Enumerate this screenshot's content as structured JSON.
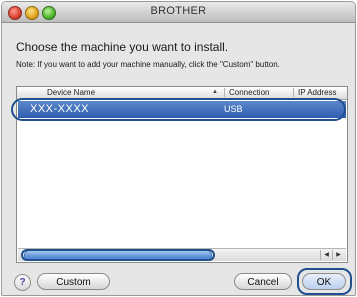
{
  "window": {
    "title": "BROTHER"
  },
  "dialog": {
    "heading": "Choose the machine you want to install.",
    "note": "Note: If you want to add your machine manually, click the \"Custom\" button."
  },
  "table": {
    "columns": [
      "Device Name",
      "Connection",
      "IP Address"
    ],
    "sort_indicator": "▲",
    "rows": [
      {
        "name": "XXX-XXXX",
        "connection": "USB",
        "selected": true
      }
    ]
  },
  "scrollbar": {
    "left_arrow": "◀",
    "right_arrow": "▶"
  },
  "buttons": {
    "help": "?",
    "custom": "Custom",
    "cancel": "Cancel",
    "ok": "OK"
  }
}
